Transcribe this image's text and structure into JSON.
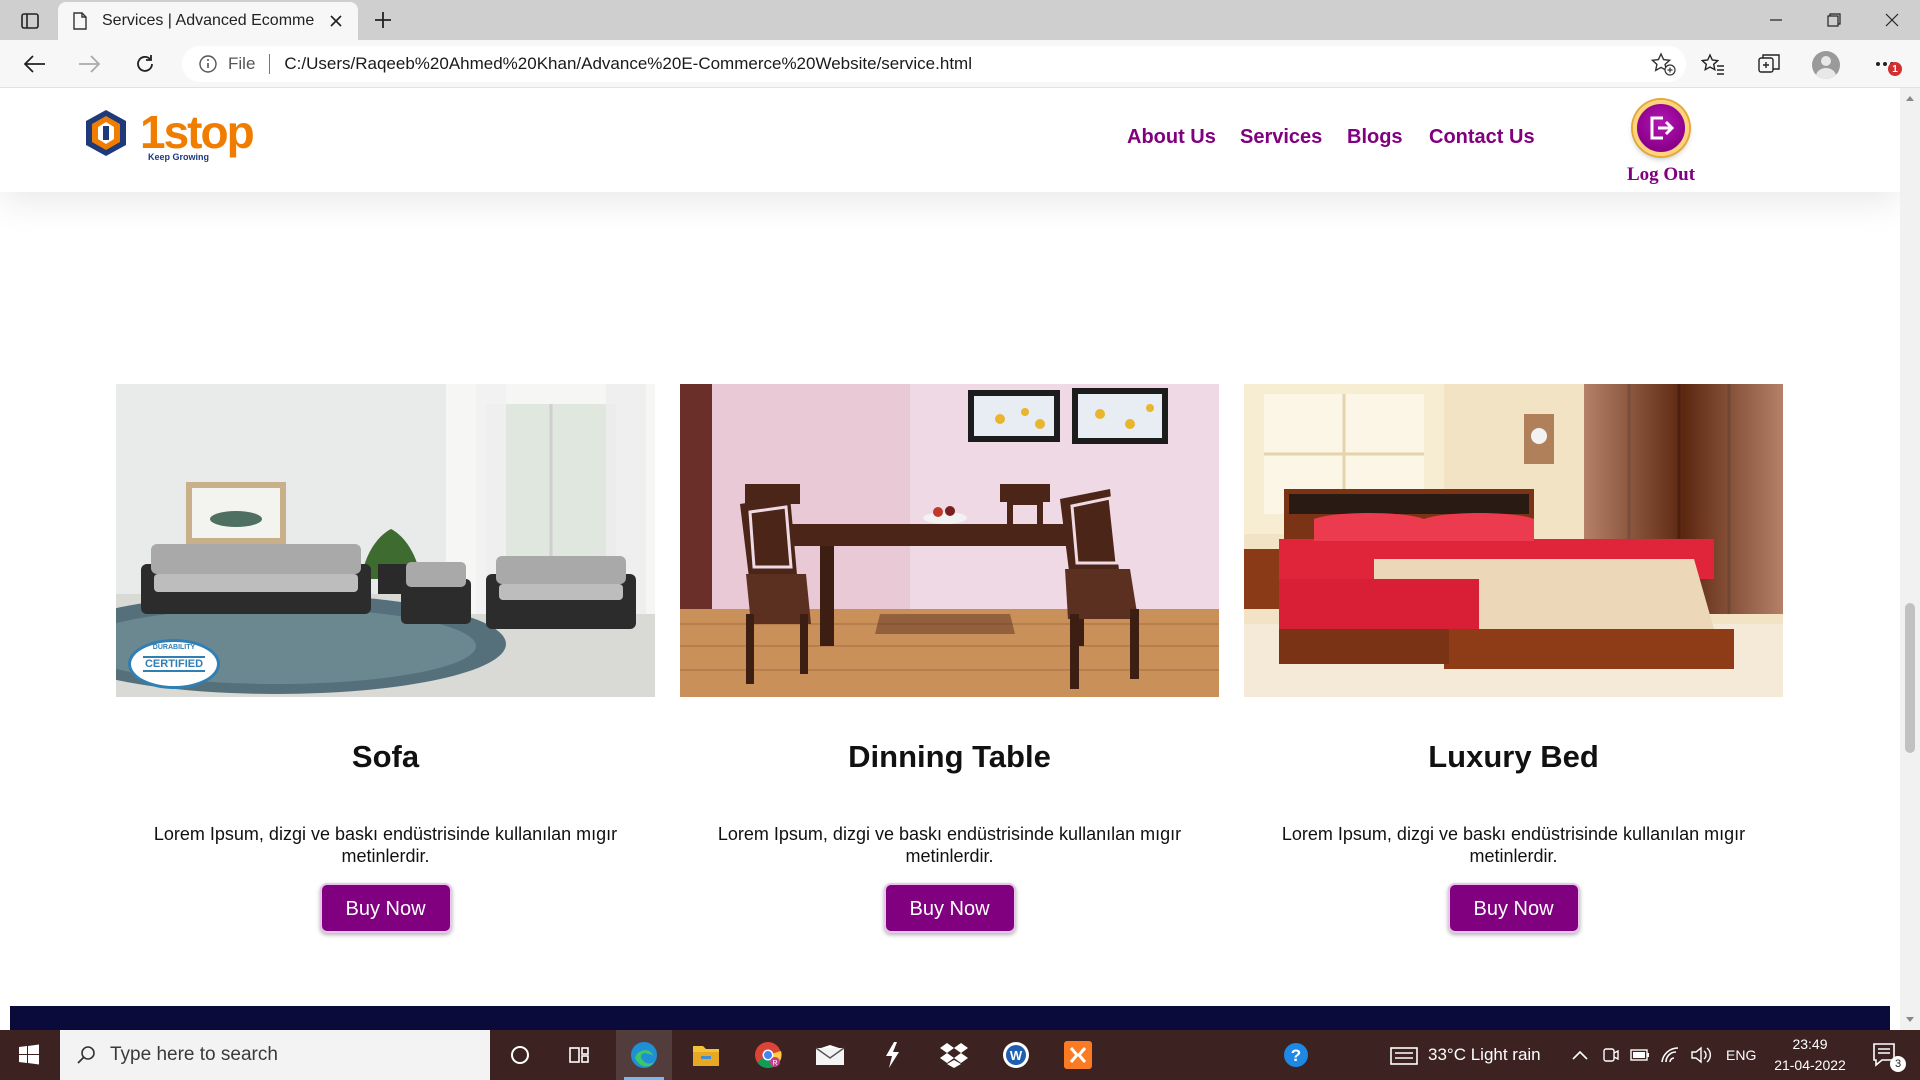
{
  "browser": {
    "tab_title": "Services | Advanced Ecommerce",
    "address_scheme_label": "File",
    "url": "C:/Users/Raqeeb%20Ahmed%20Khan/Advance%20E-Commerce%20Website/service.html",
    "menu_badge": "1"
  },
  "site": {
    "logo_text": "1stop",
    "logo_tagline": "Keep Growing",
    "nav": [
      "About Us",
      "Services",
      "Blogs",
      "Contact Us"
    ],
    "logout_label": "Log Out"
  },
  "products": [
    {
      "title": "Sofa",
      "description": "Lorem Ipsum, dizgi ve baskı endüstrisinde kullanılan mıgır metinlerdir.",
      "button": "Buy Now",
      "badge": "CERTIFIED",
      "badge_ring": "DURABILITY"
    },
    {
      "title": "Dinning Table",
      "description": "Lorem Ipsum, dizgi ve baskı endüstrisinde kullanılan mıgır metinlerdir.",
      "button": "Buy Now"
    },
    {
      "title": "Luxury Bed",
      "description": "Lorem Ipsum, dizgi ve baskı endüstrisinde kullanılan mıgır metinlerdir.",
      "button": "Buy Now"
    }
  ],
  "taskbar": {
    "search_placeholder": "Type here to search",
    "weather": "33°C  Light rain",
    "language": "ENG",
    "time": "23:49",
    "date": "21-04-2022",
    "notification_count": "3",
    "pinned_icons": [
      "task-view-icon",
      "edge-icon",
      "file-explorer-icon",
      "chrome-icon",
      "mail-icon",
      "winamp-icon",
      "dropbox-icon",
      "word-icon",
      "xampp-icon",
      "help-icon"
    ]
  },
  "colors": {
    "brand_purple": "#800080",
    "footer_navy": "#0b0b3b",
    "logo_orange": "#f07d00",
    "logo_blue": "#1d3a7a"
  }
}
